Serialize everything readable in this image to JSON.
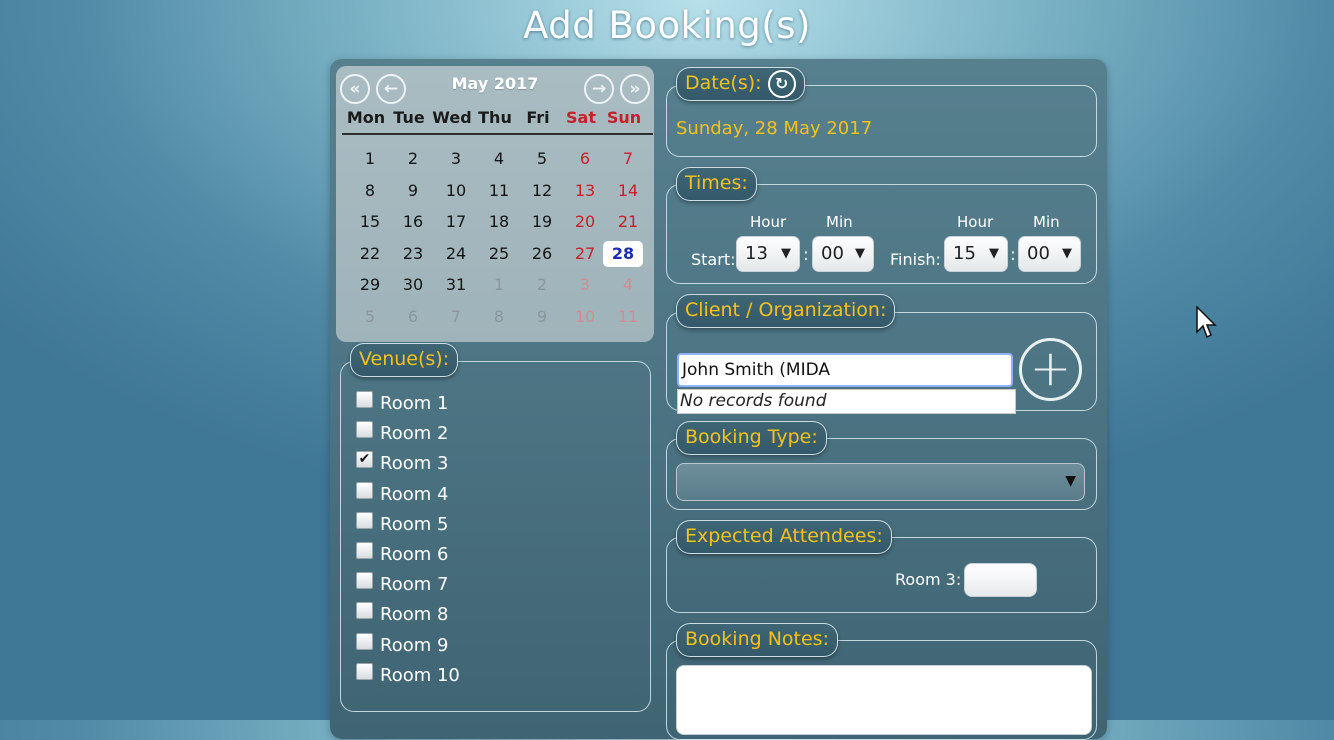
{
  "page": {
    "title": "Add Booking(s)"
  },
  "calendar": {
    "month_label": "May 2017",
    "nav": {
      "first": "«",
      "prev": "←",
      "next": "→",
      "last": "»"
    },
    "weekdays": [
      "Mon",
      "Tue",
      "Wed",
      "Thu",
      "Fri",
      "Sat",
      "Sun"
    ],
    "weeks": [
      [
        "1",
        "2",
        "3",
        "4",
        "5",
        "6",
        "7"
      ],
      [
        "8",
        "9",
        "10",
        "11",
        "12",
        "13",
        "14"
      ],
      [
        "15",
        "16",
        "17",
        "18",
        "19",
        "20",
        "21"
      ],
      [
        "22",
        "23",
        "24",
        "25",
        "26",
        "27",
        "28"
      ],
      [
        "29",
        "30",
        "31",
        "1",
        "2",
        "3",
        "4"
      ],
      [
        "5",
        "6",
        "7",
        "8",
        "9",
        "10",
        "11"
      ]
    ],
    "selected_day": "28",
    "colors": {
      "weekend": "#c8202a",
      "selected": "#1a2fb0"
    }
  },
  "dates": {
    "legend": "Date(s):",
    "go_icon": "redo-arrow-icon",
    "value": "Sunday, 28 May 2017"
  },
  "times": {
    "legend": "Times:",
    "hour_label": "Hour",
    "min_label": "Min",
    "start_label": "Start:",
    "finish_label": "Finish:",
    "colon": ":",
    "start_hour": "13",
    "start_min": "00",
    "finish_hour": "15",
    "finish_min": "00",
    "arrow": "▼"
  },
  "client": {
    "legend": "Client / Organization:",
    "input_value": "John Smith (MIDA",
    "no_records": "No records found",
    "add_icon": "plus-circle-icon",
    "add_glyph": "+"
  },
  "booking_type": {
    "legend": "Booking Type:",
    "value": "",
    "arrow": "▼"
  },
  "attendees": {
    "legend": "Expected Attendees:",
    "room_label": "Room 3:"
  },
  "notes": {
    "legend": "Booking Notes:"
  },
  "venues": {
    "legend": "Venue(s):",
    "items": [
      {
        "label": "Room 1",
        "checked": false
      },
      {
        "label": "Room 2",
        "checked": false
      },
      {
        "label": "Room 3",
        "checked": true
      },
      {
        "label": "Room 4",
        "checked": false
      },
      {
        "label": "Room 5",
        "checked": false
      },
      {
        "label": "Room 6",
        "checked": false
      },
      {
        "label": "Room 7",
        "checked": false
      },
      {
        "label": "Room 8",
        "checked": false
      },
      {
        "label": "Room 9",
        "checked": false
      },
      {
        "label": "Room 10",
        "checked": false
      }
    ],
    "check_glyph": "✔"
  },
  "theme": {
    "legend_text": "#f5c21c",
    "accent_border": "#8fb2ff"
  }
}
